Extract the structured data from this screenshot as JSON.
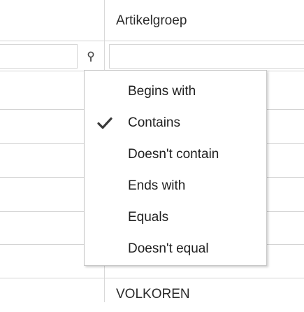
{
  "grid": {
    "column_header": "Artikelgroep",
    "filter": {
      "value": "",
      "filter_icon": "funnel-pin-icon"
    },
    "visible_cell": "VOLKOREN"
  },
  "filter_menu": {
    "items": [
      {
        "label": "Begins with",
        "checked": false
      },
      {
        "label": "Contains",
        "checked": true
      },
      {
        "label": "Doesn't contain",
        "checked": false
      },
      {
        "label": "Ends with",
        "checked": false
      },
      {
        "label": "Equals",
        "checked": false
      },
      {
        "label": "Doesn't equal",
        "checked": false
      }
    ],
    "check_icon": "checkmark-icon"
  }
}
